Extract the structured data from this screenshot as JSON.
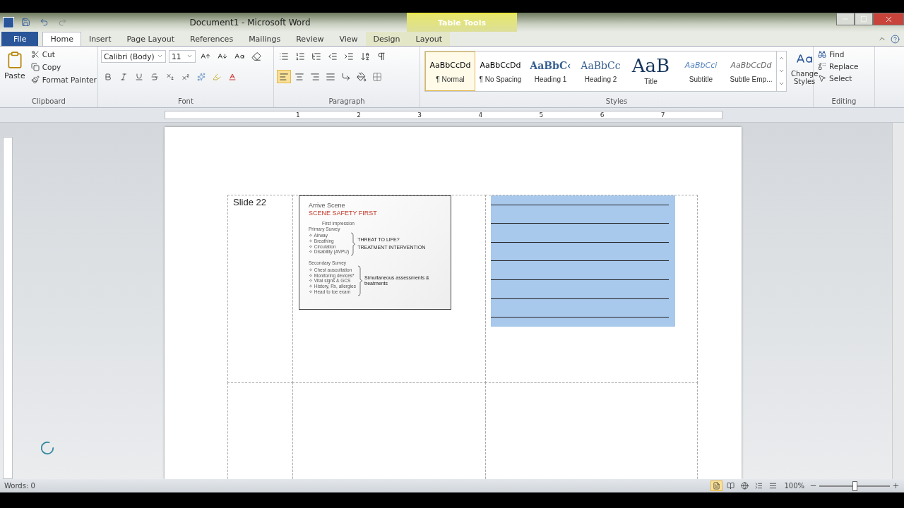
{
  "title_bar": {
    "title": "Document1 - Microsoft Word",
    "context_tab": "Table Tools"
  },
  "tabs": [
    {
      "label": "File",
      "kind": "file",
      "selected": false
    },
    {
      "label": "Home",
      "kind": "normal",
      "selected": true
    },
    {
      "label": "Insert",
      "kind": "normal",
      "selected": false
    },
    {
      "label": "Page Layout",
      "kind": "normal",
      "selected": false
    },
    {
      "label": "References",
      "kind": "normal",
      "selected": false
    },
    {
      "label": "Mailings",
      "kind": "normal",
      "selected": false
    },
    {
      "label": "Review",
      "kind": "normal",
      "selected": false
    },
    {
      "label": "View",
      "kind": "normal",
      "selected": false
    },
    {
      "label": "Design",
      "kind": "context",
      "selected": false
    },
    {
      "label": "Layout",
      "kind": "context",
      "selected": false
    }
  ],
  "clipboard": {
    "paste": "Paste",
    "cut": "Cut",
    "copy": "Copy",
    "format_painter": "Format Painter",
    "label": "Clipboard"
  },
  "font": {
    "font_name": "Calibri (Body)",
    "font_size": "11",
    "label": "Font"
  },
  "paragraph": {
    "label": "Paragraph",
    "alignments": [
      {
        "kind": "left",
        "selected": true
      },
      {
        "kind": "center",
        "selected": false
      },
      {
        "kind": "right",
        "selected": false
      },
      {
        "kind": "justify",
        "selected": false
      }
    ]
  },
  "styles": {
    "label": "Styles",
    "change_styles": "Change Styles",
    "items": [
      {
        "preview": "AaBbCcDd",
        "name": "¶ Normal",
        "kind": "plain",
        "selected": true
      },
      {
        "preview": "AaBbCcDd",
        "name": "¶ No Spacing",
        "kind": "plain",
        "selected": false
      },
      {
        "preview": "AaBbC‹",
        "name": "Heading 1",
        "kind": "heading1",
        "selected": false
      },
      {
        "preview": "AaBbCc",
        "name": "Heading 2",
        "kind": "heading2",
        "selected": false
      },
      {
        "preview": "AaB",
        "name": "Title",
        "kind": "title",
        "selected": false
      },
      {
        "preview": "AaBbCci",
        "name": "Subtitle",
        "kind": "subtitle",
        "selected": false
      },
      {
        "preview": "AaBbCcDd",
        "name": "Subtle Emp...",
        "kind": "emphasis",
        "selected": false
      }
    ]
  },
  "editing": {
    "find": "Find",
    "replace": "Replace",
    "select": "Select",
    "label": "Editing"
  },
  "ruler": {
    "numbers": [
      "1",
      "2",
      "3",
      "4",
      "5",
      "6",
      "7"
    ]
  },
  "document": {
    "table": {
      "rows": [
        {
          "label": "Slide 22",
          "slide": {
            "heading": "Arrive Scene",
            "title": "SCENE SAFETY FIRST",
            "first": "First impression",
            "primary": "Primary Survey",
            "primary_items": [
              "✧ Airway",
              "✧ Breathing",
              "✧ Circulation",
              "✧ Disability (AVPU)"
            ],
            "threat": "THREAT TO LIFE?",
            "treatment": "TREATMENT INTERVENTION",
            "secondary": "Secondary Survey",
            "secondary_items": [
              "✧ Chest auscultation",
              "✧ Monitoring devices*",
              "✧ Vital signs & GCS",
              "✧ History, Rx, allergies",
              "✧ Head to toe exam"
            ],
            "simultaneous": "Simultaneous assessments & treatments"
          },
          "notes_selected": true
        },
        {
          "notes_selected": false
        }
      ]
    }
  },
  "status_bar": {
    "words": "Words: 0",
    "views": [
      {
        "kind": "print",
        "selected": true
      },
      {
        "kind": "reading",
        "selected": false
      },
      {
        "kind": "web",
        "selected": false
      },
      {
        "kind": "outline",
        "selected": false
      },
      {
        "kind": "draft",
        "selected": false
      }
    ],
    "zoom": "100%",
    "zoom_slider": {
      "level": 0.5
    }
  }
}
